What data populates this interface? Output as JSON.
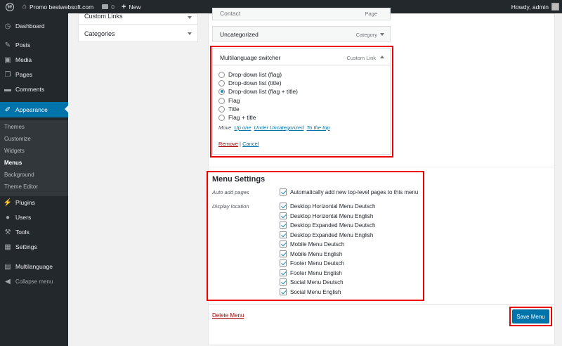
{
  "adminbar": {
    "site_name": "Promo bestwebsoft.com",
    "comments_count": "0",
    "new_label": "New",
    "howdy": "Howdy, admin"
  },
  "sidebar": {
    "items": [
      {
        "label": "Dashboard",
        "icon": "dashboard-icon"
      },
      {
        "label": "Posts",
        "icon": "pin-icon"
      },
      {
        "label": "Media",
        "icon": "media-icon"
      },
      {
        "label": "Pages",
        "icon": "pages-icon"
      },
      {
        "label": "Comments",
        "icon": "comments-icon"
      },
      {
        "label": "Appearance",
        "icon": "brush-icon"
      },
      {
        "label": "Plugins",
        "icon": "plugin-icon"
      },
      {
        "label": "Users",
        "icon": "users-icon"
      },
      {
        "label": "Tools",
        "icon": "wrench-icon"
      },
      {
        "label": "Settings",
        "icon": "settings-icon"
      },
      {
        "label": "Multilanguage",
        "icon": "multilanguage-icon"
      },
      {
        "label": "Collapse menu",
        "icon": "collapse-icon"
      }
    ],
    "appearance_sub": [
      "Themes",
      "Customize",
      "Widgets",
      "Menus",
      "Background",
      "Theme Editor"
    ]
  },
  "left_boxes": {
    "custom_links": "Custom Links",
    "categories": "Categories"
  },
  "menu_items": {
    "contact": {
      "title": "Contact",
      "type": "Page"
    },
    "uncategorized": {
      "title": "Uncategorized",
      "type": "Category"
    },
    "ml_switcher": {
      "title": "Multilanguage switcher",
      "type": "Custom Link"
    }
  },
  "switcher_options": [
    {
      "label": "Drop-down list (flag)",
      "checked": false
    },
    {
      "label": "Drop-down list (title)",
      "checked": false
    },
    {
      "label": "Drop-down list (flag + title)",
      "checked": true
    },
    {
      "label": "Flag",
      "checked": false
    },
    {
      "label": "Title",
      "checked": false
    },
    {
      "label": "Flag + title",
      "checked": false
    }
  ],
  "move": {
    "label": "Move",
    "up_one": "Up one",
    "under": "Under Uncategorized",
    "to_top": "To the top"
  },
  "item_actions": {
    "remove": "Remove",
    "sep": "|",
    "cancel": "Cancel"
  },
  "menu_settings": {
    "title": "Menu Settings",
    "auto_add_label": "Auto add pages",
    "auto_add_text": "Automatically add new top-level pages to this menu",
    "display_location_label": "Display location",
    "locations": [
      "Desktop Horizontal Menu Deutsch",
      "Desktop Horizontal Menu English",
      "Desktop Expanded Menu Deutsch",
      "Desktop Expanded Menu English",
      "Mobile Menu Deutsch",
      "Mobile Menu English",
      "Footer Menu Deutsch",
      "Footer Menu English",
      "Social Menu Deutsch",
      "Social Menu English"
    ]
  },
  "footer": {
    "delete_menu": "Delete Menu",
    "save_menu": "Save Menu"
  },
  "colors": {
    "accent": "#0073aa",
    "highlight_border": "#e00000",
    "sidebar_bg": "#23282d"
  }
}
